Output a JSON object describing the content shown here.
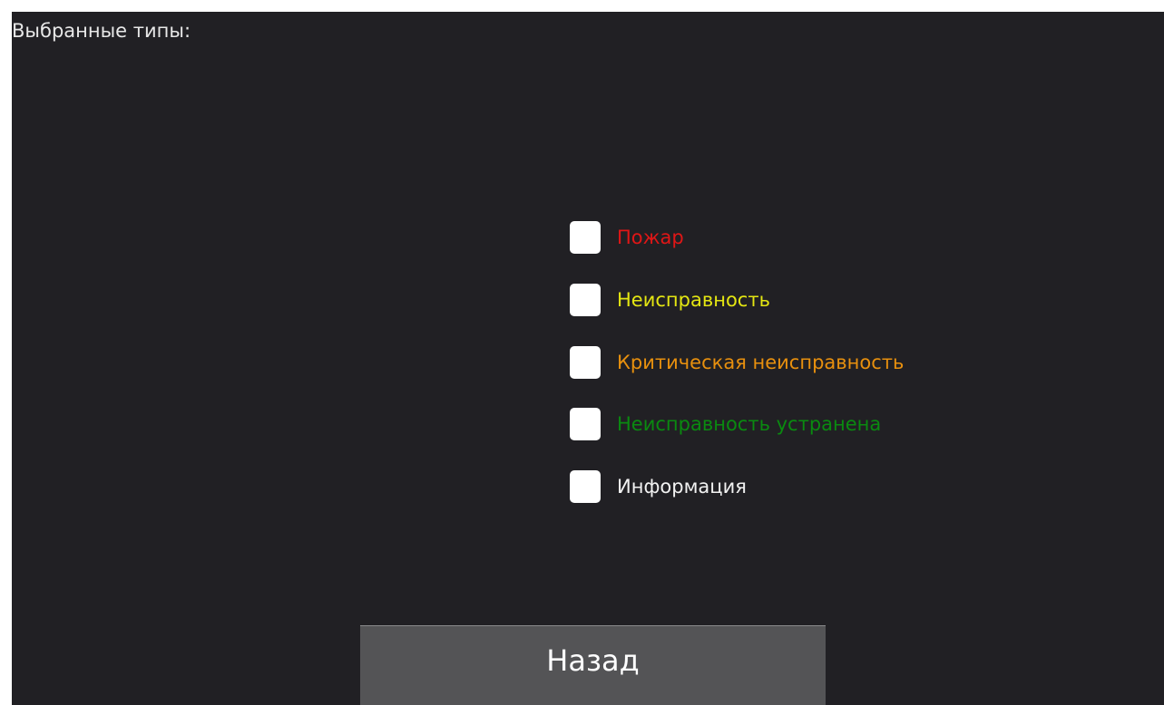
{
  "header": {
    "title": "Выбранные типы:"
  },
  "event_types": [
    {
      "label": "Пожар",
      "color": "#e01616",
      "checked": false
    },
    {
      "label": "Неисправность",
      "color": "#e4e612",
      "checked": false
    },
    {
      "label": "Критическая неисправность",
      "color": "#e8900e",
      "checked": false
    },
    {
      "label": "Неисправность устранена",
      "color": "#0a8a10",
      "checked": false
    },
    {
      "label": "Информация",
      "color": "#f2f2f2",
      "checked": false
    }
  ],
  "footer": {
    "back_label": "Назад"
  },
  "colors": {
    "background": "#212024",
    "button_background": "#545456",
    "checkbox": "#ffffff"
  }
}
